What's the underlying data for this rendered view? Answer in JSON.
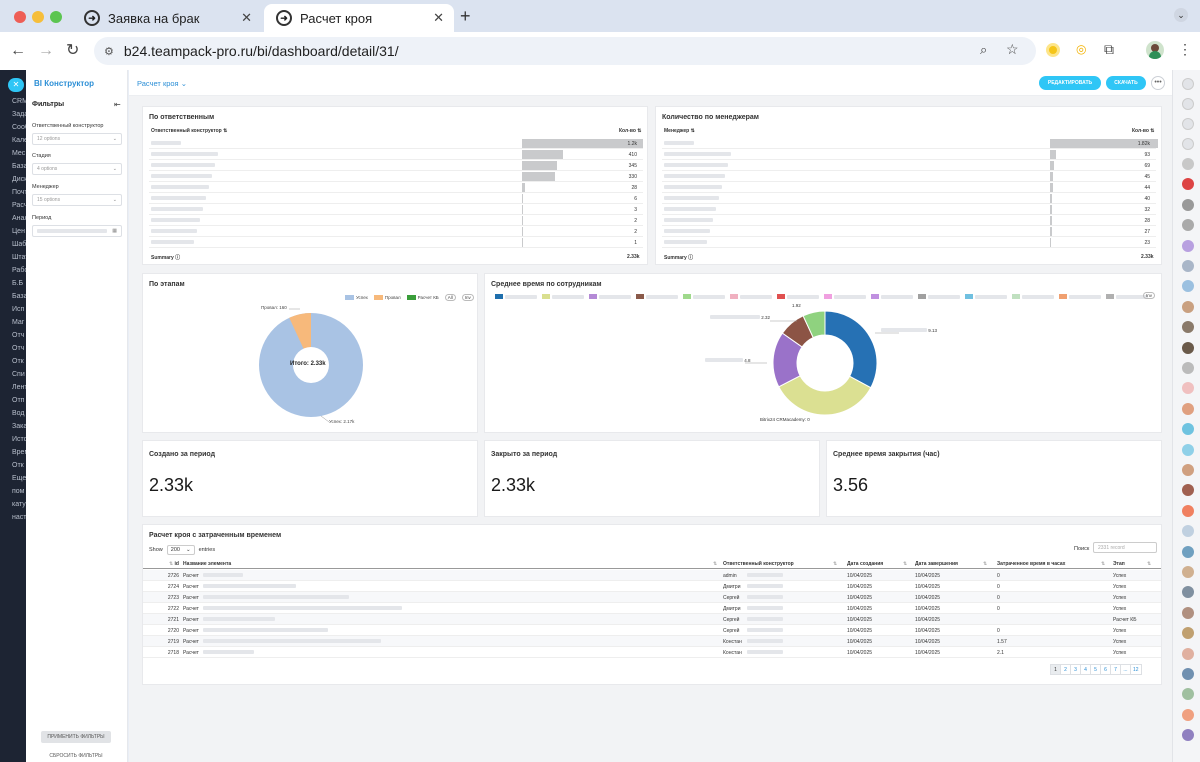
{
  "browser": {
    "tabs": [
      {
        "label": "Заявка на брак",
        "active": false
      },
      {
        "label": "Расчет кроя",
        "active": true
      }
    ],
    "url": "b24.teampack-pro.ru/bi/dashboard/detail/31/"
  },
  "sidebar_dark": {
    "items": [
      "CRM",
      "Зада",
      "Сооб",
      "Кале",
      "Мес",
      "База",
      "Диск",
      "Почт",
      "Расч",
      "Анал",
      "Цен",
      "Шаб",
      "Штат",
      "Рабо",
      "Б.Б",
      "База",
      "Исп",
      "Маг",
      "Отч",
      "Отч",
      "Отк",
      "Спи",
      "Лента",
      "Отп",
      "Вод",
      "Зака",
      "Исто",
      "Врем",
      "Отк",
      "Еще",
      "пом",
      "кату",
      "наст"
    ]
  },
  "filters": {
    "brand": "BI Конструктор",
    "title": "Фильтры",
    "fields": [
      {
        "label": "Ответственный конструктор",
        "value": "12 options"
      },
      {
        "label": "Стадия",
        "value": "4 options"
      },
      {
        "label": "Менеджер",
        "value": "15 options"
      },
      {
        "label": "Период",
        "value": ""
      }
    ],
    "apply": "ПРИМЕНИТЬ ФИЛЬТРЫ",
    "reset": "СБРОСИТЬ ФИЛЬТРЫ"
  },
  "dashboard": {
    "title": "Расчет кроя",
    "edit": "РЕДАКТИРОВАТЬ",
    "download": "СКАЧАТЬ"
  },
  "responsible": {
    "title": "По ответственным",
    "col1": "Ответственный конструктор",
    "col2": "Кол-во",
    "values": [
      "1.2k",
      "410",
      "345",
      "330",
      "28",
      "6",
      "3",
      "2",
      "2",
      "1"
    ],
    "bars": [
      1200,
      410,
      345,
      330,
      28,
      6,
      3,
      2,
      2,
      1
    ],
    "summary_label": "Summary",
    "summary": "2.33k"
  },
  "managers": {
    "title": "Количество по менеджерам",
    "col1": "Менеджер",
    "col2": "Кол-во",
    "values": [
      "1.82k",
      "93",
      "69",
      "45",
      "44",
      "40",
      "32",
      "28",
      "27",
      "23"
    ],
    "bars": [
      1820,
      93,
      69,
      45,
      44,
      40,
      32,
      28,
      27,
      23
    ],
    "summary_label": "Summary",
    "summary": "2.33k"
  },
  "stages": {
    "title": "По этапам",
    "legend": [
      "Успех",
      "Провал",
      "Расчет КБ"
    ],
    "legend_colors": [
      "#a9c3e4",
      "#f7b97b",
      "#3a9e3a"
    ],
    "page": "1/1",
    "center": "Итого: 2.33k",
    "label_fail": "Провал: 160",
    "label_success": "Успех: 2.17k"
  },
  "avgtime": {
    "title": "Среднее время по сотрудникам",
    "labels": [
      "9.13",
      "1.92",
      "2.32",
      "4.8",
      "Bitrix24 CRMacademy: 0"
    ]
  },
  "kpi": [
    {
      "title": "Создано за период",
      "value": "2.33k"
    },
    {
      "title": "Закрыто за период",
      "value": "2.33k"
    },
    {
      "title": "Среднее время закрытия (час)",
      "value": "3.56"
    }
  ],
  "table": {
    "title": "Расчет кроя с затраченным временем",
    "show": "Show",
    "show_value": "200",
    "entries": "entries",
    "search_label": "Поиск",
    "search_placeholder": "2331 record",
    "headers": [
      "id",
      "Название элемента",
      "Ответственный конструктор",
      "Дата создания",
      "Дата завершения",
      "Затраченное время в часах",
      "Этап"
    ],
    "rows": [
      {
        "id": "2726",
        "name": "Расчет",
        "resp": "admin",
        "created": "10/04/2025",
        "closed": "10/04/2025",
        "hours": "0",
        "stage": "Успех"
      },
      {
        "id": "2724",
        "name": "Расчет",
        "resp": "Дмитри",
        "created": "10/04/2025",
        "closed": "10/04/2025",
        "hours": "0",
        "stage": "Успех"
      },
      {
        "id": "2723",
        "name": "Расчет",
        "resp": "Сергей",
        "created": "10/04/2025",
        "closed": "10/04/2025",
        "hours": "0",
        "stage": "Успех"
      },
      {
        "id": "2722",
        "name": "Расчет",
        "resp": "Дмитри",
        "created": "10/04/2025",
        "closed": "10/04/2025",
        "hours": "0",
        "stage": "Успех"
      },
      {
        "id": "2721",
        "name": "Расчет",
        "resp": "Сергей",
        "created": "10/04/2025",
        "closed": "10/04/2025",
        "hours": "",
        "stage": "Расчет КБ"
      },
      {
        "id": "2720",
        "name": "Расчет",
        "resp": "Сергей",
        "created": "10/04/2025",
        "closed": "10/04/2025",
        "hours": "0",
        "stage": "Успех"
      },
      {
        "id": "2719",
        "name": "Расчет",
        "resp": "Констан",
        "created": "10/04/2025",
        "closed": "10/04/2025",
        "hours": "1.57",
        "stage": "Успех"
      },
      {
        "id": "2718",
        "name": "Расчет",
        "resp": "Констан",
        "created": "10/04/2025",
        "closed": "10/04/2025",
        "hours": "2.1",
        "stage": "Успех"
      }
    ],
    "pages": [
      "1",
      "2",
      "3",
      "4",
      "5",
      "6",
      "7",
      "...",
      "12"
    ]
  }
}
